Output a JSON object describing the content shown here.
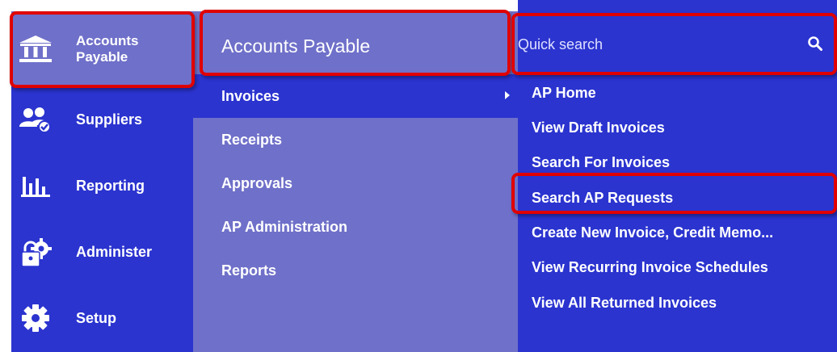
{
  "left_nav": {
    "items": [
      {
        "label_line1": "Accounts",
        "label_line2": "Payable",
        "icon": "bank-icon"
      },
      {
        "label": "Suppliers",
        "icon": "suppliers-icon"
      },
      {
        "label": "Reporting",
        "icon": "bar-chart-icon"
      },
      {
        "label": "Administer",
        "icon": "lock-gear-icon"
      },
      {
        "label": "Setup",
        "icon": "gear-icon"
      }
    ]
  },
  "middle": {
    "title": "Accounts Payable",
    "items": [
      "Invoices",
      "Receipts",
      "Approvals",
      "AP Administration",
      "Reports"
    ]
  },
  "right": {
    "search_placeholder": "Quick search",
    "items": [
      "AP Home",
      "View Draft Invoices",
      "Search For Invoices",
      "Search AP Requests",
      "Create New Invoice, Credit Memo...",
      "View Recurring Invoice Schedules",
      "View All Returned Invoices"
    ]
  },
  "colors": {
    "nav_blue": "#2b34cf",
    "light_purple": "#6f70c9",
    "highlight_red": "#e00000"
  }
}
